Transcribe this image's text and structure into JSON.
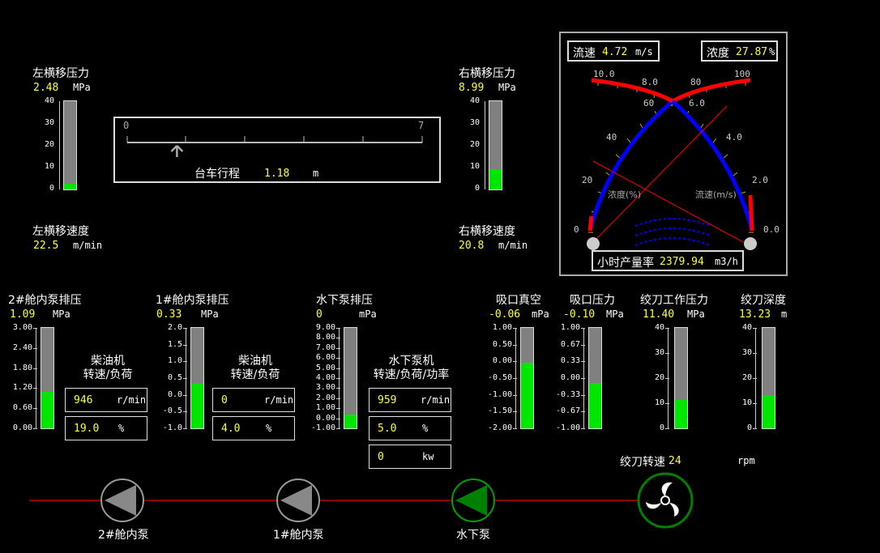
{
  "left_shift_pressure": {
    "label": "左横移压力",
    "value": "2.48",
    "unit": "MPa",
    "ticks": [
      "40",
      "30",
      "20",
      "10",
      "0"
    ],
    "level": 0.062
  },
  "right_shift_pressure": {
    "label": "右横移压力",
    "value": "8.99",
    "unit": "MPa",
    "ticks": [
      "40",
      "30",
      "20",
      "10",
      "0"
    ],
    "level": 0.225
  },
  "left_shift_speed": {
    "label": "左横移速度",
    "value": "22.5",
    "unit": "m/min"
  },
  "right_shift_speed": {
    "label": "右横移速度",
    "value": "20.8",
    "unit": "m/min"
  },
  "trolley": {
    "label": "台车行程",
    "value": "1.18",
    "unit": "m",
    "scale_min": "0",
    "scale_max": "7",
    "position": 1.18,
    "range": [
      0,
      7
    ]
  },
  "gauge": {
    "flow_label": "流速",
    "flow_value": "4.72",
    "flow_unit": "m/s",
    "conc_label": "浓度",
    "conc_value": "27.87",
    "conc_unit": "%",
    "left_ticks": [
      "0",
      "20",
      "40",
      "60",
      "80",
      "100"
    ],
    "right_ticks": [
      "0.0",
      "2.0",
      "4.0",
      "6.0",
      "8.0",
      "10.0"
    ],
    "conc_axis_label": "浓度(%)",
    "flow_axis_label": "流速(m/s)",
    "prod_label": "小时产量率",
    "prod_value": "2379.94",
    "prod_unit": "m3/h",
    "colors": {
      "blue": "#0000ff",
      "red": "#ff0000"
    }
  },
  "pump2": {
    "label": "2#舱内泵排压",
    "value": "1.09",
    "unit": "MPa",
    "ticks": [
      "3.00",
      "2.40",
      "1.80",
      "1.20",
      "0.60",
      "0.00"
    ],
    "level": 0.363
  },
  "pump1": {
    "label": "1#舱内泵排压",
    "value": "0.33",
    "unit": "MPa",
    "ticks": [
      "2.0",
      "1.5",
      "1.0",
      "0.5",
      "0.0",
      "-0.5",
      "-1.0"
    ],
    "level": 0.443
  },
  "uw_pump_press": {
    "label": "水下泵排压",
    "value": "0",
    "unit": "mPa",
    "ticks": [
      "9.00",
      "8.00",
      "7.00",
      "6.00",
      "5.00",
      "4.00",
      "3.00",
      "2.00",
      "1.00",
      "0.00",
      "-1.00"
    ],
    "level": 0.14
  },
  "diesel2": {
    "title1": "柴油机",
    "title2": "转速/负荷",
    "rpm": "946",
    "rpm_unit": "r/min",
    "load": "19.0",
    "load_unit": "%"
  },
  "diesel1": {
    "title1": "柴油机",
    "title2": "转速/负荷",
    "rpm": "0",
    "rpm_unit": "r/min",
    "load": "4.0",
    "load_unit": "%"
  },
  "uw_pump_motor": {
    "title1": "水下泵机",
    "title2": "转速/负荷/功率",
    "rpm": "959",
    "rpm_unit": "r/min",
    "load": "5.0",
    "load_unit": "%",
    "power": "0",
    "power_unit": "kw"
  },
  "suction_vac": {
    "label": "吸口真空",
    "value": "-0.06",
    "unit": "mPa",
    "ticks": [
      "1.00",
      "0.50",
      "0.00",
      "-0.50",
      "-1.00",
      "-1.50",
      "-2.00"
    ],
    "level": 0.65
  },
  "suction_press": {
    "label": "吸口压力",
    "value": "-0.10",
    "unit": "MPa",
    "ticks": [
      "1.00",
      "0.67",
      "0.33",
      "0.00",
      "-0.33",
      "-0.67",
      "-1.00"
    ],
    "level": 0.45
  },
  "cutter_press": {
    "label": "绞刀工作压力",
    "value": "11.40",
    "unit": "MPa",
    "ticks": [
      "40",
      "30",
      "20",
      "10",
      "0"
    ],
    "level": 0.285
  },
  "cutter_depth": {
    "label": "绞刀深度",
    "value": "13.23",
    "unit": "m",
    "ticks": [
      "40",
      "30",
      "20",
      "10",
      "0"
    ],
    "level": 0.33
  },
  "cutter_speed": {
    "label": "绞刀转速",
    "value": "24",
    "unit": "rpm"
  },
  "pipeline": {
    "pump2_label": "2#舱内泵",
    "pump1_label": "1#舱内泵",
    "uw_label": "水下泵",
    "line_color": "#8b0000",
    "active_color": "#008000"
  }
}
